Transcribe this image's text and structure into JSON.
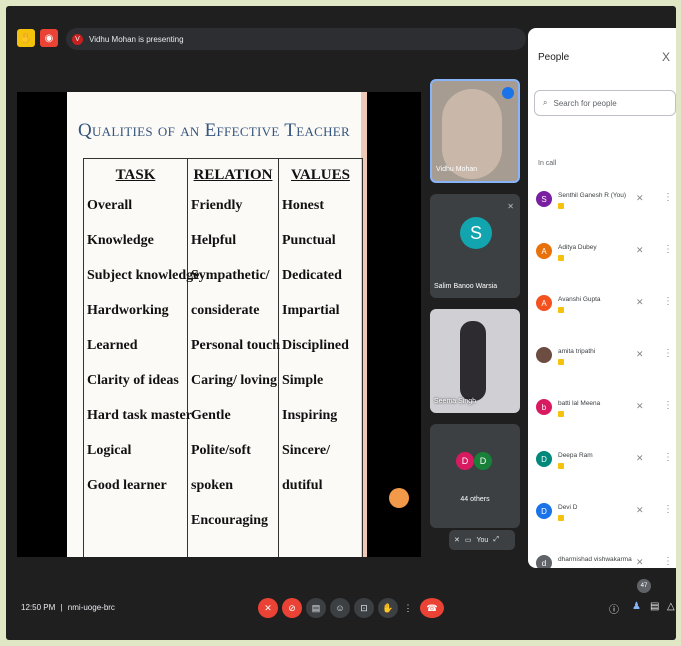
{
  "meeting": {
    "presenting_text": "Vidhu Mohan is presenting",
    "time": "12:50 PM",
    "separator": "|",
    "code": "nmi-uoge-brc"
  },
  "slide": {
    "title": "Qualities of an Effective Teacher",
    "columns": [
      {
        "header": "TASK",
        "items": [
          "Overall",
          "Knowledge",
          "Subject knowledge",
          "Hardworking",
          "Learned",
          "Clarity of ideas",
          "Hard task master",
          "Logical",
          "Good learner"
        ]
      },
      {
        "header": "RELATION",
        "items": [
          "Friendly",
          "Helpful",
          "Sympathetic/",
          "considerate",
          "Personal touch",
          "Caring/ loving",
          "Gentle",
          "Polite/soft",
          "spoken",
          "Encouraging"
        ]
      },
      {
        "header": "VALUES",
        "items": [
          "Honest",
          "Punctual",
          "Dedicated",
          "Impartial",
          "Disciplined",
          "Simple",
          "Inspiring",
          "Sincere/",
          "dutiful"
        ]
      }
    ]
  },
  "tiles": [
    {
      "name": "Vidhu Mohan"
    },
    {
      "name": "Salim Banoo Warsia",
      "initial": "S"
    },
    {
      "name": "Seema Singh"
    },
    {
      "name": "44 others",
      "initials": [
        "D",
        "D"
      ]
    }
  ],
  "self_tile": {
    "label": "You"
  },
  "people": {
    "title": "People",
    "close": "X",
    "search_placeholder": "Search for people",
    "section_label": "In call",
    "list": [
      {
        "name": "Senthil Ganesh R (You)",
        "initial": "S",
        "color": "#7b1fa2"
      },
      {
        "name": "Aditya Dubey",
        "initial": "A",
        "color": "#e8710a"
      },
      {
        "name": "Avanshi Gupta",
        "initial": "A",
        "color": "#f4511e"
      },
      {
        "name": "amita tripathi",
        "initial": "",
        "color": "#6d4c41"
      },
      {
        "name": "batti lal Meena",
        "initial": "b",
        "color": "#d81b60"
      },
      {
        "name": "Deepa Ram",
        "initial": "D",
        "color": "#00897b"
      },
      {
        "name": "Devi D",
        "initial": "D",
        "color": "#1a73e8"
      },
      {
        "name": "dharmishad vishwakarma",
        "initial": "d",
        "color": "#5f6368"
      }
    ]
  },
  "participants_count": "47",
  "icons": {
    "mic_off": "mic-off-icon",
    "cam_off": "camera-off-icon",
    "captions": "captions-icon",
    "emoji": "emoji-icon",
    "present": "present-icon",
    "raise_hand": "raise-hand-icon",
    "more": "more-options-icon",
    "end_call": "end-call-icon",
    "info": "info-icon",
    "people": "people-icon",
    "chat": "chat-icon",
    "activities": "activities-icon"
  }
}
